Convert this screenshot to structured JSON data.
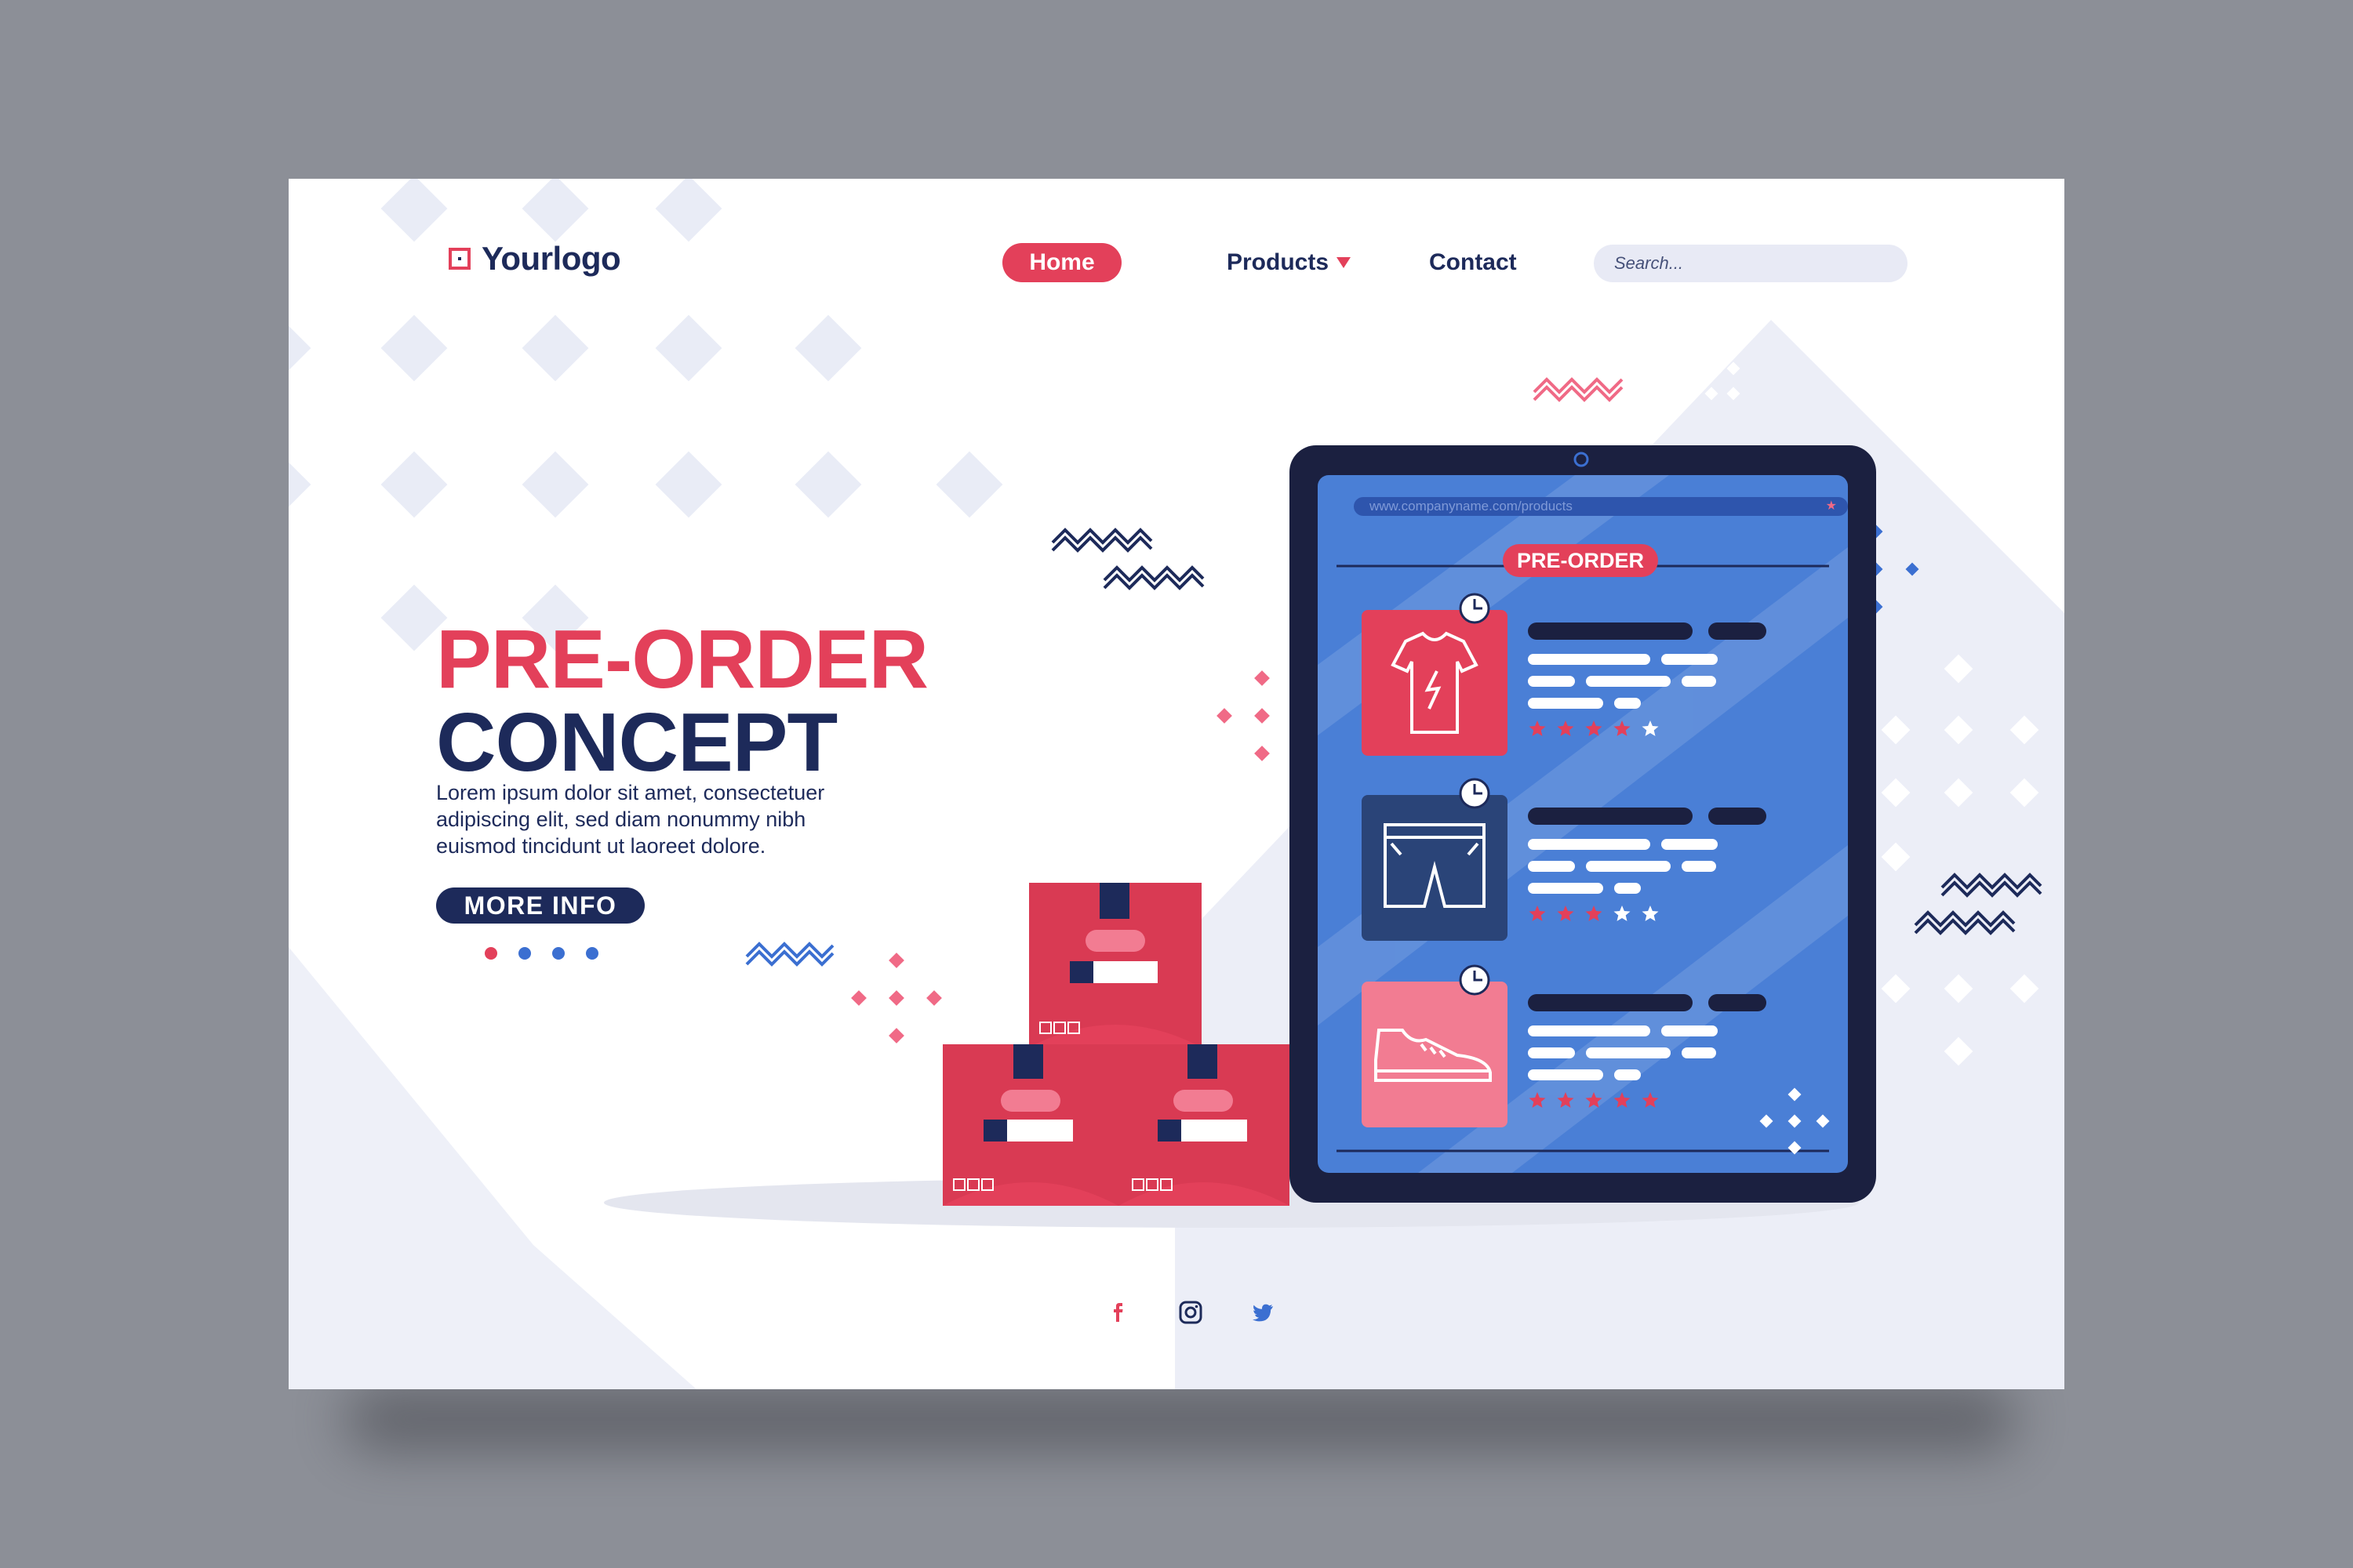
{
  "brand": {
    "logo_text": "Yourlogo"
  },
  "nav": {
    "home": "Home",
    "products": "Products",
    "contact": "Contact"
  },
  "search": {
    "placeholder": "Search..."
  },
  "hero": {
    "title_line1": "PRE-ORDER",
    "title_line2": "CONCEPT",
    "body": "Lorem ipsum dolor sit amet, consectetuer adipiscing elit, sed diam nonummy nibh euismod tincidunt ut laoreet dolore.",
    "cta": "MORE INFO"
  },
  "carousel": {
    "count": 4,
    "active_index": 0
  },
  "tablet": {
    "url": "www.companyname.com/products",
    "badge": "PRE-ORDER",
    "products": [
      {
        "icon": "tshirt-icon",
        "rating": 4,
        "max": 5
      },
      {
        "icon": "shorts-icon",
        "rating": 3,
        "max": 5
      },
      {
        "icon": "sneaker-icon",
        "rating": 5,
        "max": 5
      }
    ]
  },
  "social": [
    "facebook-icon",
    "instagram-icon",
    "twitter-icon"
  ],
  "colors": {
    "accent": "#e3405a",
    "navy": "#1d2a5a",
    "blue": "#3b6fd1",
    "tablet_screen": "#4a7fd6",
    "background": "#8c8f97"
  }
}
